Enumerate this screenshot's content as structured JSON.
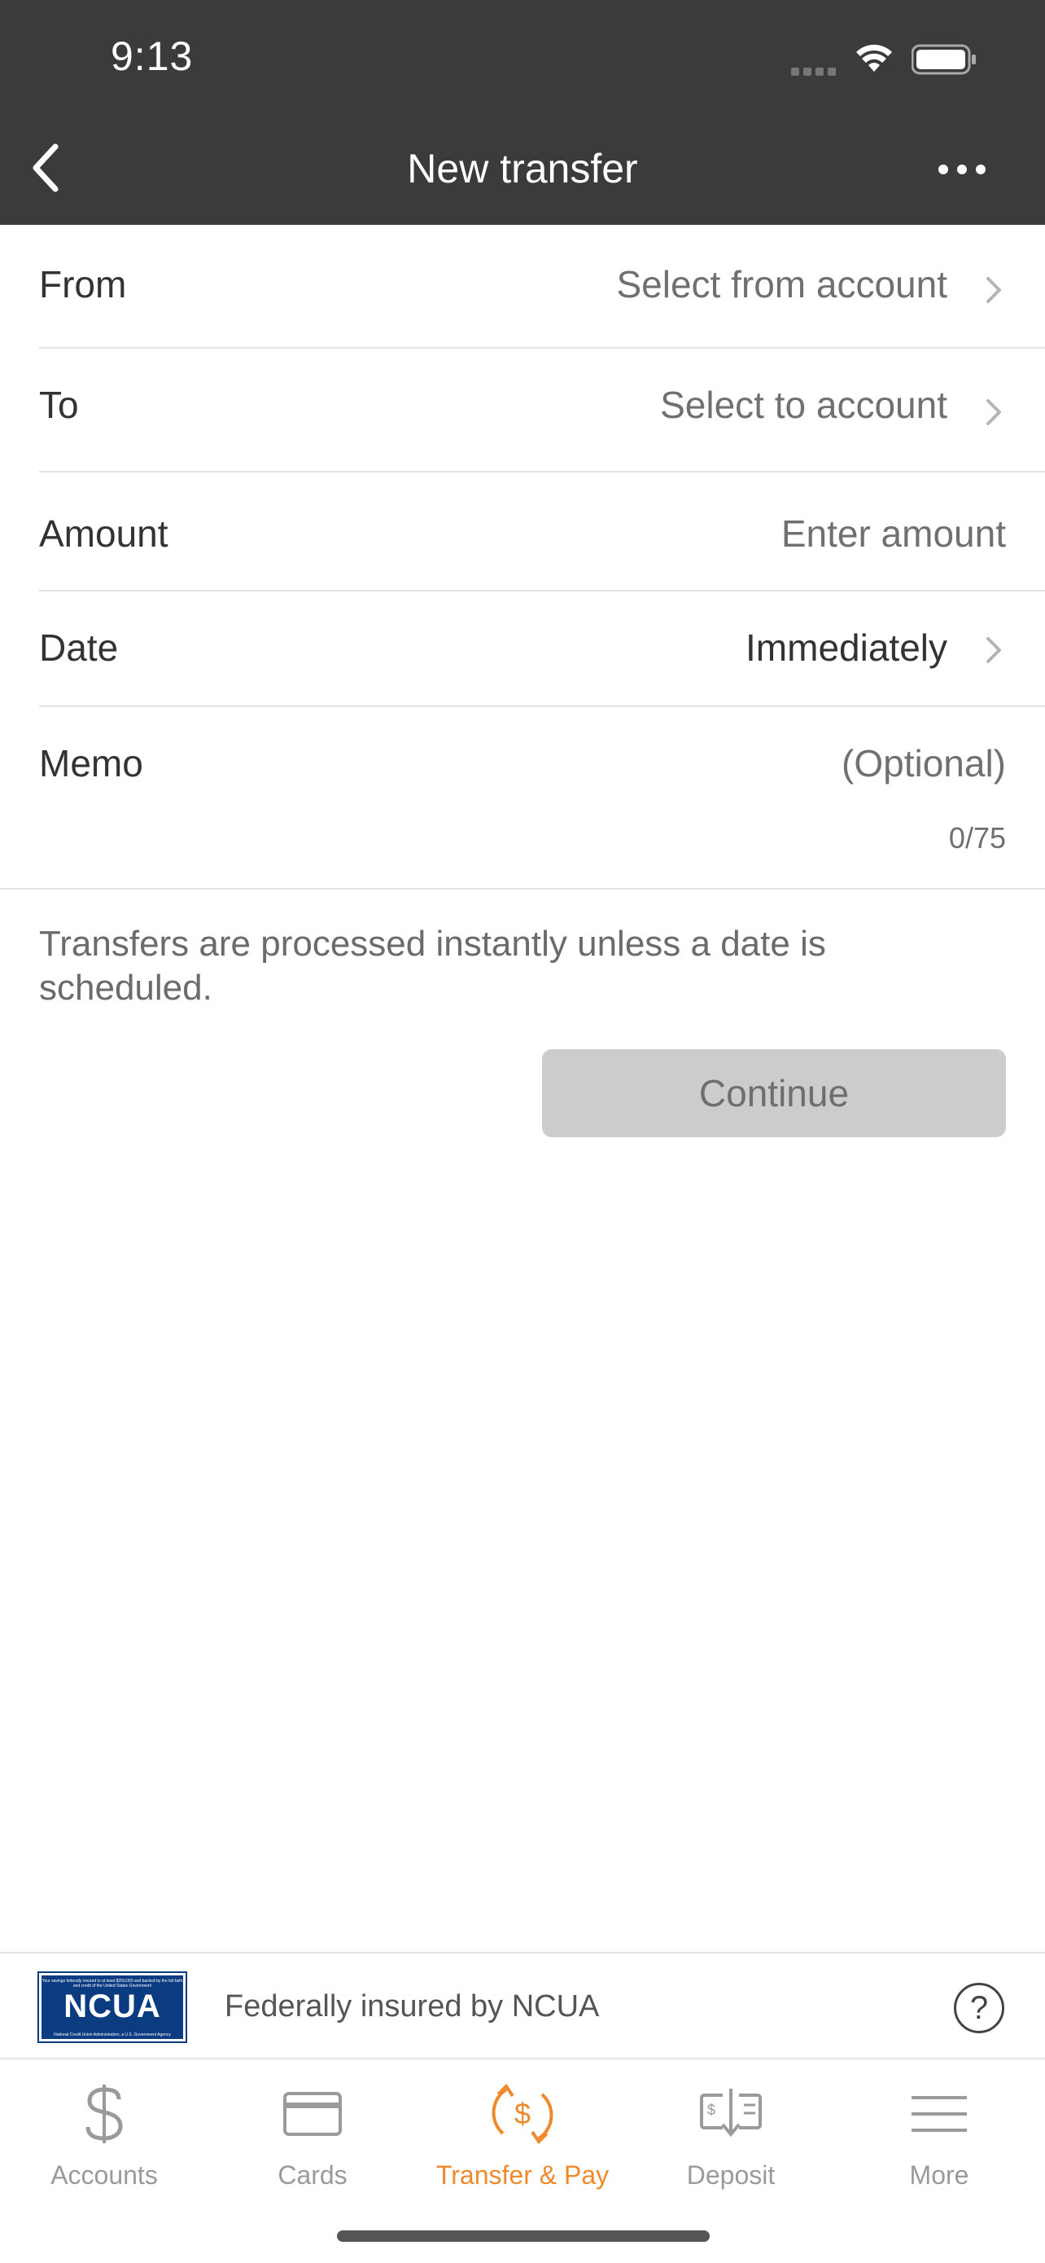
{
  "status_bar": {
    "time": "9:13"
  },
  "header": {
    "title": "New transfer",
    "back_icon": "chevron-left-icon",
    "more_icon": "ellipsis-icon"
  },
  "form": {
    "from": {
      "label": "From",
      "value": "Select from account"
    },
    "to": {
      "label": "To",
      "value": "Select to account"
    },
    "amount": {
      "label": "Amount",
      "placeholder": "Enter amount"
    },
    "date": {
      "label": "Date",
      "value": "Immediately"
    },
    "memo": {
      "label": "Memo",
      "placeholder": "(Optional)",
      "counter": "0/75"
    }
  },
  "info_text": "Transfers are processed instantly unless a date is scheduled.",
  "continue_label": "Continue",
  "ncua": {
    "logo_text": "NCUA",
    "logo_small_top": "Your savings federally insured to at least $250,000 and backed by the full faith and credit of the United States Government",
    "logo_small_bottom": "National Credit Union Administration, a U.S. Government Agency",
    "text": "Federally insured by NCUA",
    "help_label": "?"
  },
  "tabs": [
    {
      "label": "Accounts",
      "icon": "dollar-icon",
      "active": false
    },
    {
      "label": "Cards",
      "icon": "card-icon",
      "active": false
    },
    {
      "label": "Transfer & Pay",
      "icon": "transfer-pay-icon",
      "active": true
    },
    {
      "label": "Deposit",
      "icon": "deposit-check-icon",
      "active": false
    },
    {
      "label": "More",
      "icon": "menu-icon",
      "active": false
    }
  ],
  "colors": {
    "header_bg": "#3b3b3b",
    "accent": "#ee8a2b",
    "button_disabled": "#cccccc",
    "ncua_blue": "#0b3b80"
  }
}
